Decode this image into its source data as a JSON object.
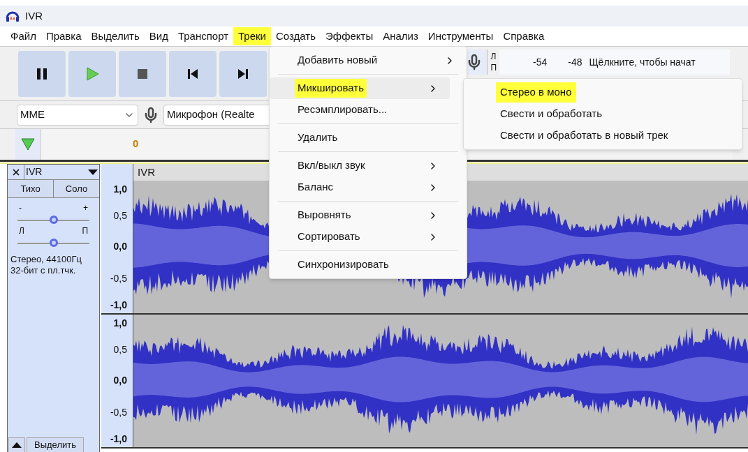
{
  "window": {
    "title": "IVR"
  },
  "menu_bar": [
    {
      "label": "Файл",
      "selected": false
    },
    {
      "label": "Правка",
      "selected": false
    },
    {
      "label": "Выделить",
      "selected": false
    },
    {
      "label": "Вид",
      "selected": false
    },
    {
      "label": "Транспорт",
      "selected": false
    },
    {
      "label": "Треки",
      "selected": true
    },
    {
      "label": "Создать",
      "selected": false
    },
    {
      "label": "Эффекты",
      "selected": false
    },
    {
      "label": "Анализ",
      "selected": false
    },
    {
      "label": "Инструменты",
      "selected": false
    },
    {
      "label": "Справка",
      "selected": false
    }
  ],
  "device_toolbar": {
    "host": "MME",
    "input": "Микрофон (Realte"
  },
  "meter": {
    "channels": [
      "Л",
      "П"
    ],
    "ticks": [
      "-54",
      "-48"
    ],
    "hint": "Щёлкните, чтобы начат"
  },
  "timeline": {
    "start": "0"
  },
  "track": {
    "name": "IVR",
    "mute": "Тихо",
    "solo": "Соло",
    "gain": {
      "min": "-",
      "max": "+",
      "level": 0.5
    },
    "pan": {
      "left": "Л",
      "right": "П",
      "level": 0.5
    },
    "info": [
      "Стерео, 44100Гц",
      "32-бит с пл.тчк."
    ],
    "select": "Выделить",
    "clip_name": "IVR",
    "channels": [
      {
        "scale": [
          "1,0",
          "0,5",
          "0,0",
          "-0,5",
          "-1,0"
        ]
      },
      {
        "scale": [
          "1,0",
          "0,5",
          "0,0",
          "-0,5",
          "-1,0"
        ]
      }
    ]
  },
  "tracks_menu": {
    "sections": [
      [
        {
          "label": "Добавить новый",
          "submenu": true,
          "highlighted": false
        }
      ],
      [
        {
          "label": "Микшировать",
          "submenu": true,
          "highlighted": true
        },
        {
          "label": "Ресэмплировать...",
          "submenu": false,
          "highlighted": false
        }
      ],
      [
        {
          "label": "Удалить",
          "submenu": false,
          "highlighted": false
        }
      ],
      [
        {
          "label": "Вкл/выкл звук",
          "submenu": true,
          "highlighted": false
        },
        {
          "label": "Баланс",
          "submenu": true,
          "highlighted": false
        }
      ],
      [
        {
          "label": "Выровнять",
          "submenu": true,
          "highlighted": false
        },
        {
          "label": "Сортировать",
          "submenu": true,
          "highlighted": false
        }
      ],
      [
        {
          "label": "Синхронизировать",
          "submenu": false,
          "highlighted": false
        }
      ]
    ]
  },
  "mix_submenu": [
    {
      "label": "Стерео в моно",
      "highlighted": true
    },
    {
      "label": "Свести и обработать",
      "highlighted": false
    },
    {
      "label": "Свести и обработать в новый трек",
      "highlighted": false
    }
  ]
}
